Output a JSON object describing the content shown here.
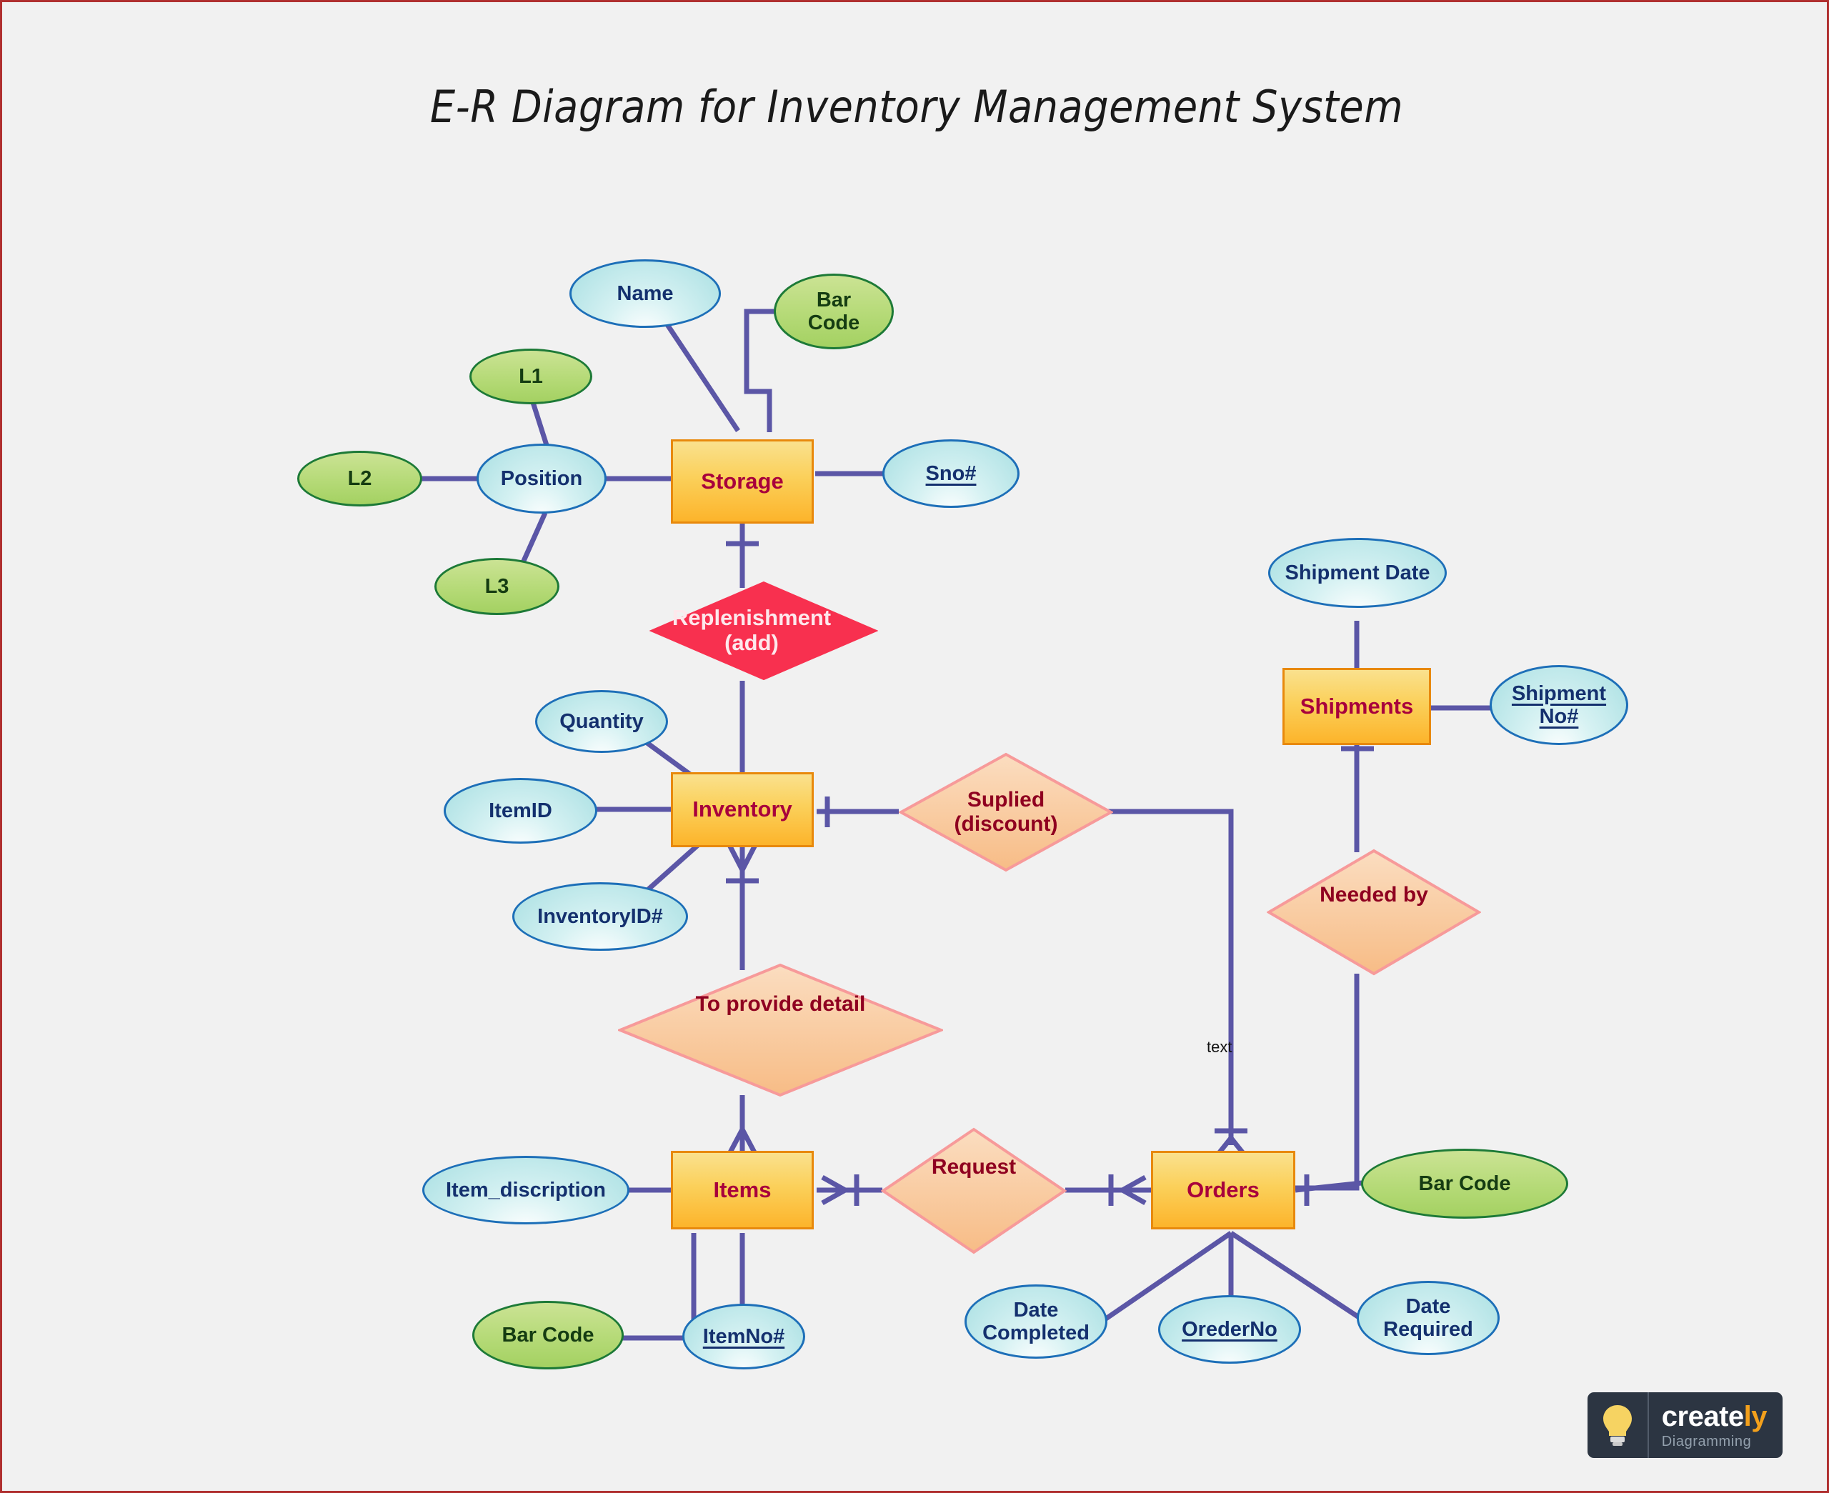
{
  "title": "E-R Diagram for Inventory Management System",
  "diagram": {
    "type": "er-diagram",
    "notation": "crow's foot",
    "colors": {
      "background": "#f1f1f1",
      "page_border": "#b03030",
      "entity_fill": "#fbd05a",
      "entity_border": "#e8890c",
      "entity_text": "#a8003c",
      "attribute_blue_fill": "#cdeef0",
      "attribute_blue_border": "#1d6fb8",
      "attribute_blue_text": "#14306e",
      "attribute_green_fill": "#b5da77",
      "attribute_green_border": "#1d7a37",
      "attribute_green_text": "#153c12",
      "relationship_peach_fill": "#f7c391",
      "relationship_peach_border": "#f79a9a",
      "relationship_red_fill": "#f8304f",
      "relationship_text": "#8f0020",
      "connector": "#5b56a6"
    },
    "entities": [
      {
        "id": "storage",
        "label": "Storage"
      },
      {
        "id": "inventory",
        "label": "Inventory"
      },
      {
        "id": "items",
        "label": "Items"
      },
      {
        "id": "orders",
        "label": "Orders"
      },
      {
        "id": "shipments",
        "label": "Shipments"
      }
    ],
    "relationships": [
      {
        "id": "replenishment",
        "label_line1": "Replenishment",
        "label_line2": "(add)",
        "style": "red",
        "between": [
          "Storage",
          "Inventory"
        ]
      },
      {
        "id": "suplied",
        "label_line1": "Suplied",
        "label_line2": "(discount)",
        "style": "peach",
        "between": [
          "Inventory",
          "Orders"
        ]
      },
      {
        "id": "to_provide_detail",
        "label_line1": "To provide detail",
        "label_line2": "",
        "style": "peach",
        "between": [
          "Inventory",
          "Items"
        ]
      },
      {
        "id": "request",
        "label_line1": "Request",
        "label_line2": "",
        "style": "peach",
        "between": [
          "Items",
          "Orders"
        ]
      },
      {
        "id": "needed_by",
        "label_line1": "Needed by",
        "label_line2": "",
        "style": "peach",
        "between": [
          "Shipments",
          "Orders"
        ]
      }
    ],
    "attributes": [
      {
        "id": "name",
        "label": "Name",
        "style": "blue",
        "key": false,
        "owner": "Storage"
      },
      {
        "id": "barcode_storage",
        "label_line1": "Bar",
        "label_line2": "Code",
        "style": "green",
        "key": false,
        "owner": "Storage"
      },
      {
        "id": "sno",
        "label": "Sno#",
        "style": "blue",
        "key": true,
        "owner": "Storage"
      },
      {
        "id": "position",
        "label": "Position",
        "style": "blue",
        "key": false,
        "owner": "Storage",
        "composite": true
      },
      {
        "id": "l1",
        "label": "L1",
        "style": "green",
        "key": false,
        "owner": "Position"
      },
      {
        "id": "l2",
        "label": "L2",
        "style": "green",
        "key": false,
        "owner": "Position"
      },
      {
        "id": "l3",
        "label": "L3",
        "style": "green",
        "key": false,
        "owner": "Position"
      },
      {
        "id": "quantity",
        "label": "Quantity",
        "style": "blue",
        "key": false,
        "owner": "Inventory"
      },
      {
        "id": "itemid",
        "label": "ItemID",
        "style": "blue",
        "key": false,
        "owner": "Inventory"
      },
      {
        "id": "inventoryid",
        "label": "InventoryID#",
        "style": "blue",
        "key": false,
        "owner": "Inventory"
      },
      {
        "id": "item_discription",
        "label": "Item_discription",
        "style": "blue",
        "key": false,
        "owner": "Items"
      },
      {
        "id": "barcode_items",
        "label": "Bar Code",
        "style": "green",
        "key": false,
        "owner": "Items"
      },
      {
        "id": "itemno",
        "label": "ItemNo#",
        "style": "blue",
        "key": true,
        "owner": "Items"
      },
      {
        "id": "date_completed",
        "label_line1": "Date",
        "label_line2": "Completed",
        "style": "blue",
        "key": false,
        "owner": "Orders"
      },
      {
        "id": "orederno",
        "label": "OrederNo",
        "style": "blue",
        "key": true,
        "owner": "Orders"
      },
      {
        "id": "date_required",
        "label_line1": "Date",
        "label_line2": "Required",
        "style": "blue",
        "key": false,
        "owner": "Orders"
      },
      {
        "id": "barcode_orders",
        "label": "Bar Code",
        "style": "green",
        "key": false,
        "owner": "Orders"
      },
      {
        "id": "shipment_date",
        "label": "Shipment Date",
        "style": "blue",
        "key": false,
        "owner": "Shipments"
      },
      {
        "id": "shipment_no",
        "label_line1": "Shipment",
        "label_line2": "No#",
        "style": "blue",
        "key": true,
        "owner": "Shipments"
      }
    ],
    "line_labels": [
      {
        "id": "text_label",
        "label": "text"
      }
    ]
  },
  "logo": {
    "word_main": "create",
    "word_accent": "ly",
    "subtitle": "Diagramming",
    "icon": "lightbulb-icon"
  }
}
